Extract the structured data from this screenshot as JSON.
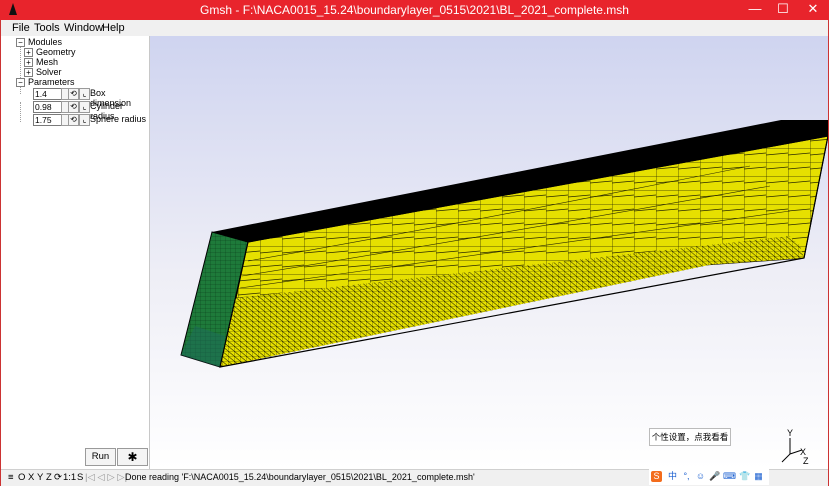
{
  "window": {
    "title": "Gmsh - F:\\NACA0015_15.24\\boundarylayer_0515\\2021\\BL_2021_complete.msh",
    "minimize": "—",
    "maximize": "☐",
    "close": "✕"
  },
  "menubar": {
    "file": "File",
    "tools": "Tools",
    "window": "Window",
    "help": "Help"
  },
  "tree": {
    "modules": "Modules",
    "geometry": "Geometry",
    "mesh": "Mesh",
    "solver": "Solver",
    "parameters": "Parameters",
    "expander_plus": "+",
    "expander_minus": "−"
  },
  "parameters": [
    {
      "value": "1.4",
      "label": "Box dimension"
    },
    {
      "value": "0.98",
      "label": "Cylinder radius"
    },
    {
      "value": "1.75",
      "label": "Sphere radius"
    }
  ],
  "buttons": {
    "run": "Run",
    "gear": "✱"
  },
  "statusbar": {
    "menu_icon": "≡",
    "o": "O",
    "x": "X",
    "y": "Y",
    "z": "Z",
    "rotate_icon": "⟳",
    "scale": "1:1",
    "s": "S",
    "message": "Done reading 'F:\\NACA0015_15.24\\boundarylayer_0515\\2021\\BL_2021_complete.msh'"
  },
  "axes": {
    "x": "X",
    "y": "Y",
    "z": "Z"
  },
  "ime": {
    "tip": "个性设置，点我看看",
    "logo": "S",
    "lang": "中",
    "punct": "°,",
    "emoji": "☺",
    "mic": "🎤",
    "keyboard": "⌨",
    "skin": "👕",
    "grid": "▦"
  },
  "colors": {
    "titlebar": "#e8242c",
    "mesh_yellow": "#e6e000",
    "mesh_green": "#1e7a3a",
    "mesh_top": "#000000",
    "mesh_lines": "#2a2a00"
  }
}
